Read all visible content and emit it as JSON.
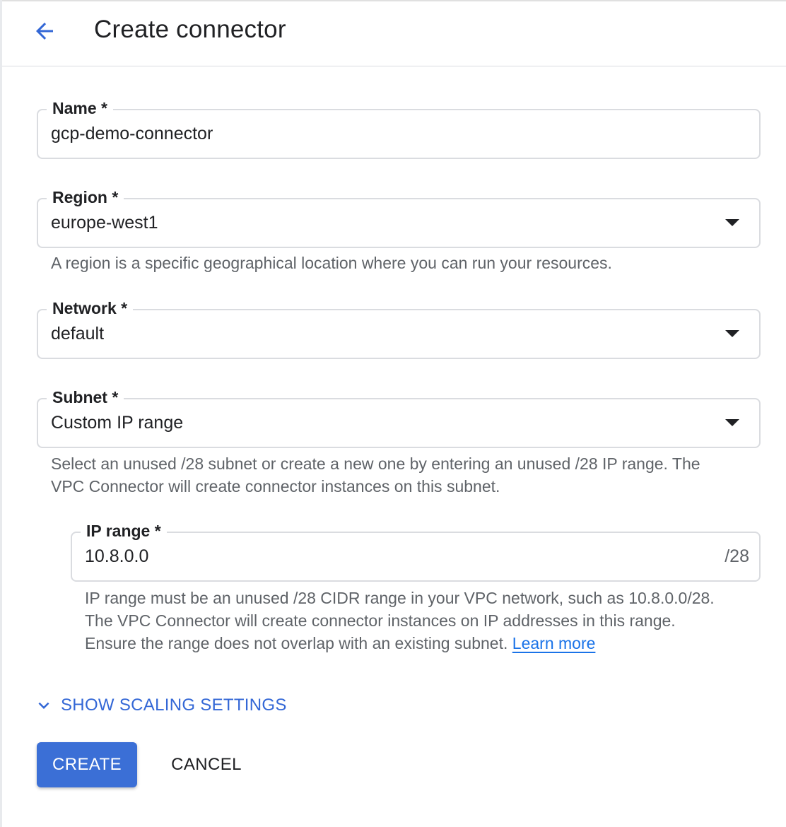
{
  "header": {
    "title": "Create connector",
    "back_icon": "arrow-left-icon"
  },
  "fields": {
    "name": {
      "label": "Name *",
      "value": "gcp-demo-connector"
    },
    "region": {
      "label": "Region *",
      "value": "europe-west1",
      "hint": "A region is a specific geographical location where you can run your resources."
    },
    "network": {
      "label": "Network *",
      "value": "default"
    },
    "subnet": {
      "label": "Subnet *",
      "value": "Custom IP range",
      "hint_lines": [
        "Select an unused /28 subnet or create a new one by entering an unused /28 IP range. The",
        "VPC Connector will create connector instances on this subnet."
      ]
    },
    "ip_range": {
      "label": "IP range *",
      "value": "10.8.0.0",
      "suffix": "/28",
      "hint_lines": [
        "IP range must be an unused /28 CIDR range in your VPC network, such as 10.8.0.0/28.",
        "The VPC Connector will create connector instances on IP addresses in this range.",
        "Ensure the range does not overlap with an existing subnet. "
      ],
      "learn_more": "Learn more"
    }
  },
  "scaling": {
    "label": "SHOW SCALING SETTINGS",
    "icon": "chevron-down-icon"
  },
  "actions": {
    "create": "CREATE",
    "cancel": "CANCEL"
  },
  "colors": {
    "primary": "#3b6fd6",
    "link": "#1a73e8",
    "accent_text": "#3367d6",
    "border": "#dadce0"
  }
}
